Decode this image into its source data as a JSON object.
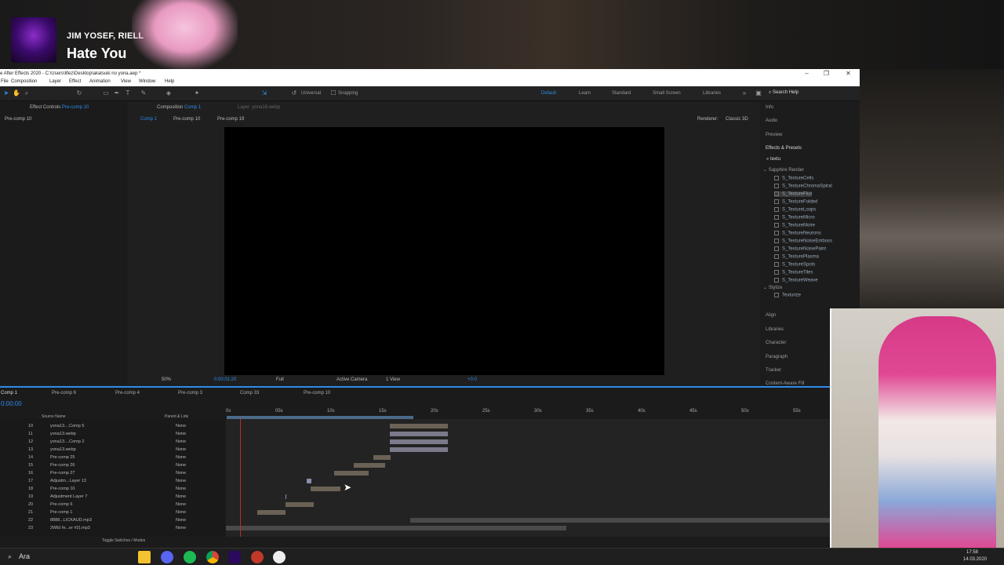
{
  "stream": {
    "artist": "JIM YOSEF, RIELL",
    "song": "Hate You"
  },
  "app": {
    "title": "e After Effects 2020 - C:\\Users\\lifez\\Desktop\\akatsuki no yona.aep *",
    "menu": [
      "File",
      "Composition",
      "Layer",
      "Effect",
      "Animation",
      "View",
      "Window",
      "Help"
    ],
    "toolbar": {
      "universal": "Universal",
      "snapping": "Snapping",
      "workspaces": [
        "Default",
        "Learn",
        "Standard",
        "Small Screen",
        "Libraries"
      ],
      "search_help": "Search Help"
    },
    "left_panel": {
      "tab": "Effect Controls",
      "tab_target": "Pre-comp 10",
      "subtitle": "Pre-comp 10"
    },
    "comp_panel": {
      "tab": "Composition",
      "tab_target": "Comp 1",
      "layer_tab": "Layer: yona18.webp",
      "breadcrumbs": [
        "Comp 1",
        "Pre-comp 10",
        "Pre-comp 19"
      ],
      "renderer": "Renderer:",
      "renderer_value": "Classic 3D",
      "footer": {
        "zoom": "50%",
        "time": "0:00:01:20",
        "resolution": "Full",
        "camera": "Active Camera",
        "views": "1 View",
        "exposure": "+0.0"
      }
    },
    "right_panel": {
      "items_top": [
        "Info",
        "Audio",
        "Preview"
      ],
      "effects_title": "Effects & Presets",
      "search_value": "textu",
      "group1": "Sapphire Render",
      "effects": [
        "S_TextureCells",
        "S_TextureChromaSpiral",
        "S_TextureFlux",
        "S_TextureFolded",
        "S_TextureLoops",
        "S_TextureMicro",
        "S_TextureMoire",
        "S_TextureNeurons",
        "S_TextureNoiseEmboss",
        "S_TextureNoisePaint",
        "S_TexturePlasma",
        "S_TextureSpots",
        "S_TextureTiles",
        "S_TextureWeave"
      ],
      "group2": "Stylize",
      "group2_effects": [
        "Texturize"
      ],
      "items_bottom": [
        "Align",
        "Libraries",
        "Character",
        "Paragraph",
        "Tracker",
        "Content-Aware Fill"
      ]
    },
    "timeline": {
      "tabs": [
        "Comp 1",
        "Pre-comp 6",
        "Pre-comp 4",
        "Pre-comp 3",
        "Comp 33",
        "Pre-comp 10"
      ],
      "timecode": "0:00:00",
      "col_source": "Source Name",
      "col_parent": "Parent & Link",
      "ruler": [
        "0s",
        "05s",
        "10s",
        "15s",
        "20s",
        "25s",
        "30s",
        "35s",
        "40s",
        "45s",
        "50s",
        "55s"
      ],
      "layers": [
        {
          "num": "10",
          "name": "yona13....Comp 5",
          "parent": "None"
        },
        {
          "num": "11",
          "name": "yona13.webp",
          "parent": "None"
        },
        {
          "num": "12",
          "name": "yona13....Comp 2",
          "parent": "None"
        },
        {
          "num": "13",
          "name": "yona13.webp",
          "parent": "None"
        },
        {
          "num": "14",
          "name": "Pre-comp 25",
          "parent": "None"
        },
        {
          "num": "15",
          "name": "Pre-comp 26",
          "parent": "None"
        },
        {
          "num": "16",
          "name": "Pre-comp 27",
          "parent": "None"
        },
        {
          "num": "17",
          "name": "Adjustm...Layer 13",
          "parent": "None"
        },
        {
          "num": "18",
          "name": "Pre-comp 10",
          "parent": "None"
        },
        {
          "num": "19",
          "name": "Adjustment Layer 7",
          "parent": "None"
        },
        {
          "num": "20",
          "name": "Pre-comp 6",
          "parent": "None"
        },
        {
          "num": "21",
          "name": "Pre-comp 1",
          "parent": "None"
        },
        {
          "num": "22",
          "name": "8888...LICKAUD.mp3",
          "parent": "None"
        },
        {
          "num": "23",
          "name": "2WEI fe...er #2).mp3",
          "parent": "None"
        }
      ],
      "toggle": "Toggle Switches / Modes"
    }
  },
  "taskbar": {
    "search": "Ara",
    "time": "17:58",
    "date": "14.03.2020"
  }
}
